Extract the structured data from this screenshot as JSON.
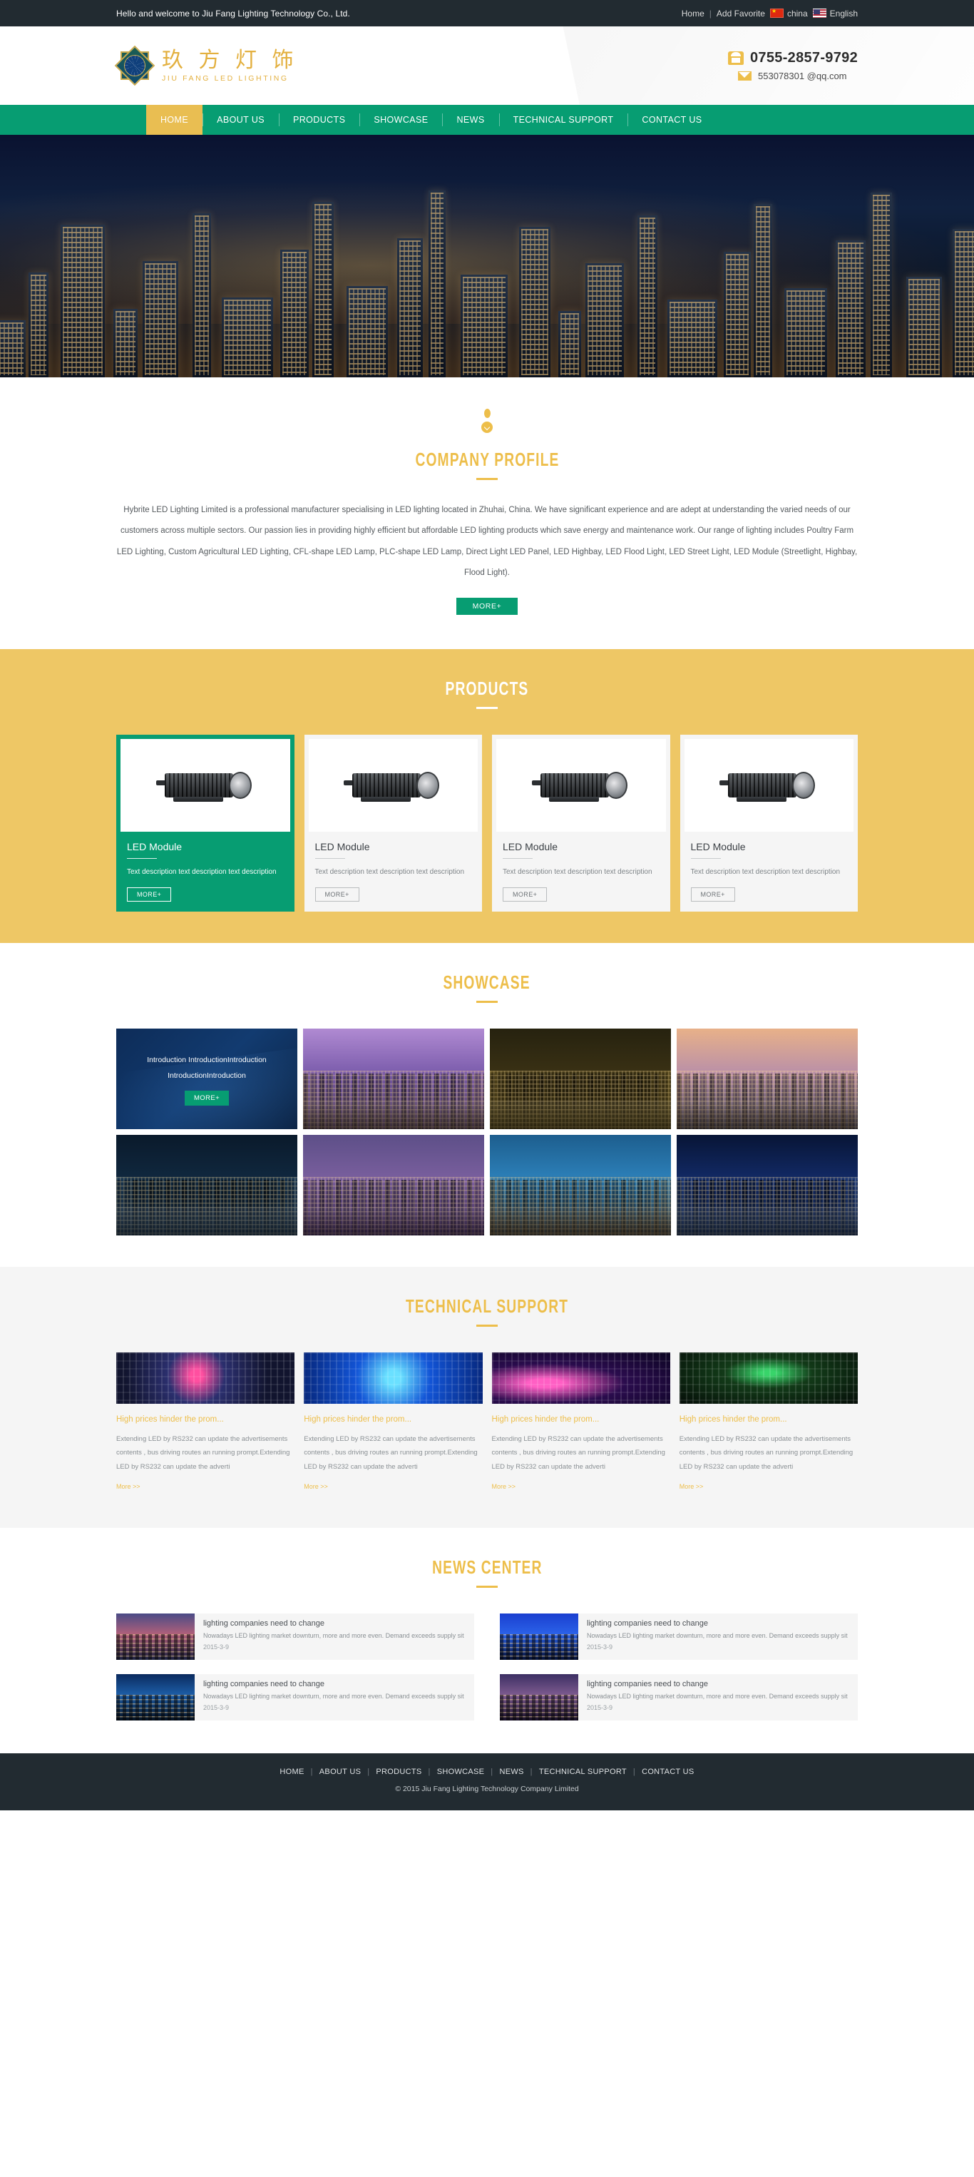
{
  "topbar": {
    "welcome": "Hello and welcome to Jiu Fang Lighting Technology Co., Ltd.",
    "home": "Home",
    "sep": "|",
    "add_favorite": "Add Favorite",
    "lang_cn": "china",
    "lang_en": "English"
  },
  "header": {
    "logo_cn": "玖 方 灯 饰",
    "logo_en": "JIU FANG LED LIGHTING",
    "phone": "0755-2857-9792",
    "email": "553078301 @qq.com"
  },
  "nav": {
    "items": [
      {
        "label": "HOME",
        "active": true
      },
      {
        "label": "ABOUT US",
        "active": false
      },
      {
        "label": "PRODUCTS",
        "active": false
      },
      {
        "label": "SHOWCASE",
        "active": false
      },
      {
        "label": "NEWS",
        "active": false
      },
      {
        "label": "TECHNICAL SUPPORT",
        "active": false
      },
      {
        "label": "CONTACT US",
        "active": false
      }
    ]
  },
  "profile": {
    "title": "COMPANY PROFILE",
    "body": "Hybrite LED Lighting Limited is a professional manufacturer specialising in LED lighting located in Zhuhai, China. We have significant experience and are adept at understanding the varied needs of our customers across multiple sectors. Our passion lies in providing highly efficient but affordable LED lighting products which save energy and maintenance work. Our range of lighting includes  Poultry Farm LED Lighting, Custom Agricultural LED Lighting, CFL-shape LED Lamp, PLC-shape LED Lamp, Direct Light LED Panel, LED Highbay, LED Flood Light, LED Street Light, LED Module (Streetlight, Highbay, Flood Light).",
    "more_label": "MORE+"
  },
  "products": {
    "title": "PRODUCTS",
    "items": [
      {
        "name": "LED Module",
        "desc": "Text description text description text description",
        "more_label": "MORE+",
        "active": true
      },
      {
        "name": "LED Module",
        "desc": "Text description text description text description",
        "more_label": "MORE+",
        "active": false
      },
      {
        "name": "LED Module",
        "desc": "Text description text description text description",
        "more_label": "MORE+",
        "active": false
      },
      {
        "name": "LED Module",
        "desc": "Text description text description text description",
        "more_label": "MORE+",
        "active": false
      }
    ]
  },
  "showcase": {
    "title": "SHOWCASE",
    "intro_text": "Introduction IntroductionIntroduction IntroductionIntroduction",
    "intro_more_label": "MORE+",
    "tiles": [
      {
        "name": "showcase-tile-intro",
        "kind": "intro"
      },
      {
        "name": "showcase-tile-purple-highrise",
        "kind": "photo",
        "sky": "linear-gradient(to bottom,#b08ad2 0%,#7e5fae 42%,#3b2c55 100%)",
        "glow": "rgba(255,200,140,.40)"
      },
      {
        "name": "showcase-tile-laser-palace",
        "kind": "photo",
        "sky": "linear-gradient(to bottom,#26220f 0%,#3a3114 45%,#141006 100%)",
        "glow": "rgba(255,215,90,.50)"
      },
      {
        "name": "showcase-tile-waterfront-skyline",
        "kind": "photo",
        "sky": "linear-gradient(to bottom,#e8b189 0%,#b98fa8 45%,#23304f 100%)",
        "glow": "rgba(255,180,120,.42)"
      },
      {
        "name": "showcase-tile-ferris-wheel",
        "kind": "photo",
        "sky": "linear-gradient(to bottom,#0a1a2b 0%,#10283f 45%,#050b14 100%)",
        "glow": "rgba(120,190,255,.45)"
      },
      {
        "name": "showcase-tile-violet-bay",
        "kind": "photo",
        "sky": "linear-gradient(to bottom,#5d4f88 0%,#7a5f9e 45%,#1d1733 100%)",
        "glow": "rgba(230,150,255,.40)"
      },
      {
        "name": "showcase-tile-harbour-blue",
        "kind": "photo",
        "sky": "linear-gradient(to bottom,#1d5e8e 0%,#2b7db5 40%,#07182c 100%)",
        "glow": "rgba(255,195,110,.45)"
      },
      {
        "name": "showcase-tile-neon-towers",
        "kind": "photo",
        "sky": "linear-gradient(to bottom,#081536 0%,#122a66 45%,#04091c 100%)",
        "glow": "rgba(110,170,255,.50)"
      }
    ]
  },
  "technical": {
    "title": "TECHNICAL SUPPORT",
    "items": [
      {
        "image_name": "led-moving-head-photo",
        "title": "High prices hinder the prom...",
        "desc": "Extending LED by RS232 can update the advertisements contents , bus driving routes an running prompt.Extending LED by RS232 can update the adverti",
        "more_label": "More >>"
      },
      {
        "image_name": "led-pixel-string-photo",
        "title": "High prices hinder the prom...",
        "desc": "Extending LED by RS232 can update the advertisements contents , bus driving routes an running prompt.Extending LED by RS232 can update the adverti",
        "more_label": "More >>"
      },
      {
        "image_name": "led-lotus-lights-photo",
        "title": "High prices hinder the prom...",
        "desc": "Extending LED by RS232 can update the advertisements contents , bus driving routes an running prompt.Extending LED by RS232 can update the adverti",
        "more_label": "More >>"
      },
      {
        "image_name": "led-rgb-array-photo",
        "title": "High prices hinder the prom...",
        "desc": "Extending LED by RS232 can update the advertisements contents , bus driving routes an running prompt.Extending LED by RS232 can update the adverti",
        "more_label": "More >>"
      }
    ]
  },
  "news": {
    "title": "NEWS CENTER",
    "items": [
      {
        "thumb_name": "news-thumb-sunset-skyline",
        "title": "lighting companies need to change",
        "summary": "Nowadays LED lighting market downturn, more and more even. Demand exceeds supply sit",
        "date": "2015-3-9"
      },
      {
        "thumb_name": "news-thumb-blue-spire",
        "title": "lighting companies need to change",
        "summary": "Nowadays LED lighting market downturn, more and more even. Demand exceeds supply sit",
        "date": "2015-3-9"
      },
      {
        "thumb_name": "news-thumb-city-night",
        "title": "lighting companies need to change",
        "summary": "Nowadays LED lighting market downturn, more and more even. Demand exceeds supply sit",
        "date": "2015-3-9"
      },
      {
        "thumb_name": "news-thumb-tower-dusk",
        "title": "lighting companies need to change",
        "summary": "Nowadays LED lighting market downturn, more and more even. Demand exceeds supply sit",
        "date": "2015-3-9"
      }
    ]
  },
  "footer": {
    "links": [
      "HOME",
      "ABOUT US",
      "PRODUCTS",
      "SHOWCASE",
      "NEWS",
      "TECHNICAL SUPPORT",
      "CONTACT US"
    ],
    "separator": "|",
    "copyright": "© 2015 Jiu Fang Lighting Technology Company Limited"
  },
  "colors": {
    "topbar_bg": "#222b31",
    "nav_green": "#079d72",
    "accent_gold": "#edbe4a",
    "products_bg": "#eec765",
    "tech_bg": "#f5f5f5"
  }
}
